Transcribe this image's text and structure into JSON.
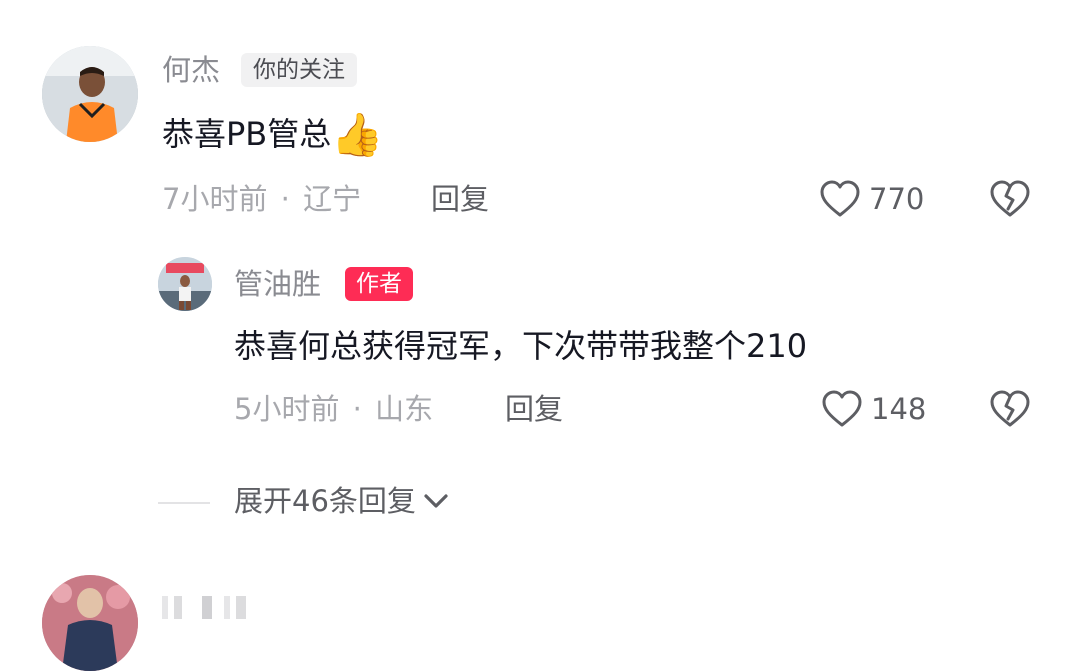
{
  "comment": {
    "username": "何杰",
    "follow_tag": "你的关注",
    "text": "恭喜PB管总",
    "emoji": "👍",
    "time": "7小时前",
    "dot": "·",
    "location": "辽宁",
    "reply_label": "回复",
    "likes": "770"
  },
  "reply": {
    "username": "管油胜",
    "author_tag": "作者",
    "text": "恭喜何总获得冠军，下次带带我整个210",
    "time": "5小时前",
    "dot": "·",
    "location": "山东",
    "reply_label": "回复",
    "likes": "148"
  },
  "expand": {
    "label": "展开46条回复"
  },
  "icons": {
    "like": "heart-outline-icon",
    "dislike": "broken-heart-icon",
    "expand": "chevron-down-icon"
  },
  "colors": {
    "author_tag": "#fe2c55",
    "meta": "#a7a8ad",
    "text": "#161823"
  }
}
